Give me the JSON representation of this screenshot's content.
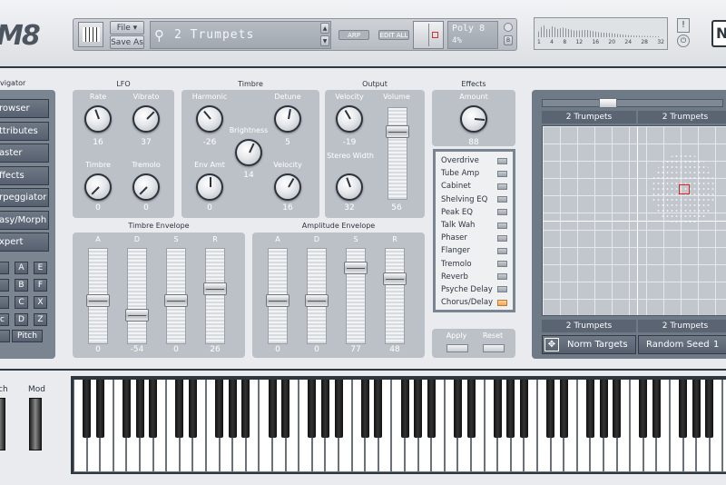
{
  "app": {
    "logo": "M8"
  },
  "header": {
    "file_label": "File ▾",
    "saveas_label": "Save As",
    "preset_name": "2 Trumpets",
    "arp_label": "ARP",
    "editall_label": "EDIT ALL",
    "poly_label": "Poly 8",
    "percent_label": "4%",
    "scope_ticks": [
      "1",
      "4",
      "8",
      "12",
      "16",
      "20",
      "24",
      "28",
      "32"
    ],
    "brand_mark": "N"
  },
  "navigator": {
    "title": "vigator",
    "items": [
      "rowser",
      "ttributes",
      "aster",
      "ffects",
      "rpeggiator",
      "asy/Morph",
      "xpert"
    ],
    "letter_grid": [
      "",
      "A",
      "E",
      "",
      "B",
      "F",
      "",
      "C",
      "X",
      "c",
      "D",
      "Z"
    ],
    "pitch_prefix": "",
    "pitch_label": "Pitch"
  },
  "lfo": {
    "title": "LFO",
    "knobs": [
      {
        "label": "Rate",
        "value": "16"
      },
      {
        "label": "Vibrato",
        "value": "37"
      },
      {
        "label": "Timbre",
        "value": "0"
      },
      {
        "label": "Tremolo",
        "value": "0"
      }
    ]
  },
  "timbre": {
    "title": "Timbre",
    "knobs": [
      {
        "label": "Harmonic",
        "value": "-26"
      },
      {
        "label": "Detune",
        "value": "5"
      },
      {
        "label": "Brightness",
        "value": "14"
      },
      {
        "label": "Env Amt",
        "value": "0"
      },
      {
        "label": "Velocity",
        "value": "16"
      }
    ]
  },
  "output": {
    "title": "Output",
    "velocity": {
      "label": "Velocity",
      "value": "-19"
    },
    "volume": {
      "label": "Volume",
      "value": "56"
    },
    "stereo": {
      "label": "Stereo Width",
      "value": "32"
    }
  },
  "effects": {
    "title": "Effects",
    "amount": {
      "label": "Amount",
      "value": "88"
    },
    "list": [
      {
        "name": "Overdrive",
        "on": false
      },
      {
        "name": "Tube Amp",
        "on": false
      },
      {
        "name": "Cabinet",
        "on": false
      },
      {
        "name": "Shelving EQ",
        "on": false
      },
      {
        "name": "Peak EQ",
        "on": false
      },
      {
        "name": "Talk Wah",
        "on": false
      },
      {
        "name": "Phaser",
        "on": false
      },
      {
        "name": "Flanger",
        "on": false
      },
      {
        "name": "Tremolo",
        "on": false
      },
      {
        "name": "Reverb",
        "on": false
      },
      {
        "name": "Psyche Delay",
        "on": false
      },
      {
        "name": "Chorus/Delay",
        "on": true
      }
    ],
    "apply_label": "Apply",
    "reset_label": "Reset"
  },
  "timbre_env": {
    "title": "Timbre Envelope",
    "faders": [
      {
        "label": "A",
        "value": "0",
        "level": 0.45
      },
      {
        "label": "D",
        "value": "-54",
        "level": 0.27
      },
      {
        "label": "S",
        "value": "0",
        "level": 0.45
      },
      {
        "label": "R",
        "value": "26",
        "level": 0.59
      }
    ]
  },
  "amp_env": {
    "title": "Amplitude Envelope",
    "faders": [
      {
        "label": "A",
        "value": "0",
        "level": 0.45
      },
      {
        "label": "D",
        "value": "0",
        "level": 0.45
      },
      {
        "label": "S",
        "value": "77",
        "level": 0.85
      },
      {
        "label": "R",
        "value": "48",
        "level": 0.71
      }
    ]
  },
  "output_volume_level": 0.78,
  "morph": {
    "top_left": "2 Trumpets",
    "top_right": "2 Trumpets",
    "bottom_left": "2 Trumpets",
    "bottom_right": "2 Trumpets",
    "norm_label": "Norm Targets",
    "seed_label": "Random Seed",
    "seed_value": "1"
  },
  "wheels": {
    "pitch_label": "ch",
    "mod_label": "Mod"
  }
}
